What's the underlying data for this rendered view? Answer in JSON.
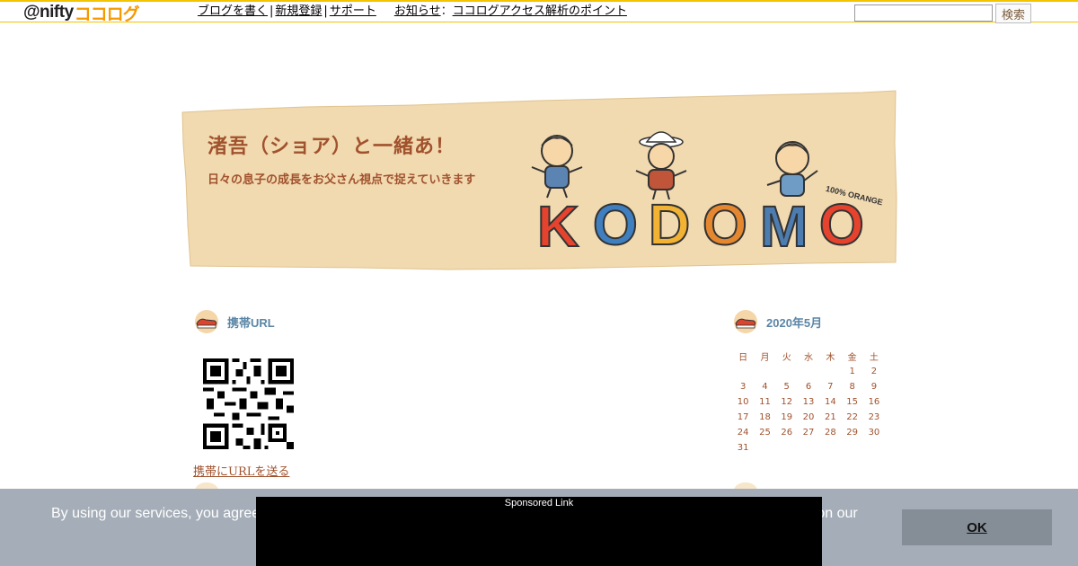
{
  "topbar": {
    "logo_at": "@nifty",
    "logo_brand": "ココログ",
    "nav": [
      {
        "label": "ブログを書く"
      },
      {
        "label": "新規登録"
      },
      {
        "label": "サポート"
      }
    ],
    "notice_label": "お知らせ",
    "notice_colon": "：",
    "notice_link": "ココログアクセス解析のポイント",
    "separator": "|",
    "search_placeholder": "",
    "search_button": "検索"
  },
  "header": {
    "title": "渚吾（ショア）と一緒あ！",
    "description": "日々の息子の成長をお父さん視点で捉えていきます",
    "logo_word": "KODOMO",
    "logo_tag": "100% ORANGE"
  },
  "sidebar_left": {
    "title": "携帯URL",
    "send_link": "携帯にURLを送る"
  },
  "sidebar_right": {
    "title": "2020年5月",
    "calendar": {
      "weekdays": [
        "日",
        "月",
        "火",
        "水",
        "木",
        "金",
        "土"
      ],
      "weeks": [
        [
          "",
          "",
          "",
          "",
          "",
          "1",
          "2"
        ],
        [
          "3",
          "4",
          "5",
          "6",
          "7",
          "8",
          "9"
        ],
        [
          "10",
          "11",
          "12",
          "13",
          "14",
          "15",
          "16"
        ],
        [
          "17",
          "18",
          "19",
          "20",
          "21",
          "22",
          "23"
        ],
        [
          "24",
          "25",
          "26",
          "27",
          "28",
          "29",
          "30"
        ],
        [
          "31",
          "",
          "",
          "",
          "",
          "",
          ""
        ]
      ]
    }
  },
  "consent": {
    "text_left": "By using our services, you agree",
    "text_right": "ce on our",
    "ok_label": "OK"
  },
  "sponsored": {
    "label": "Sponsored Link"
  },
  "colors": {
    "accent_yellow": "#f3c400",
    "brand_orange": "#f59a00",
    "text_brown": "#a0522d",
    "title_blue": "#5b86a6",
    "consent_bg": "#a5aeb8",
    "ok_bg": "#858d97"
  }
}
